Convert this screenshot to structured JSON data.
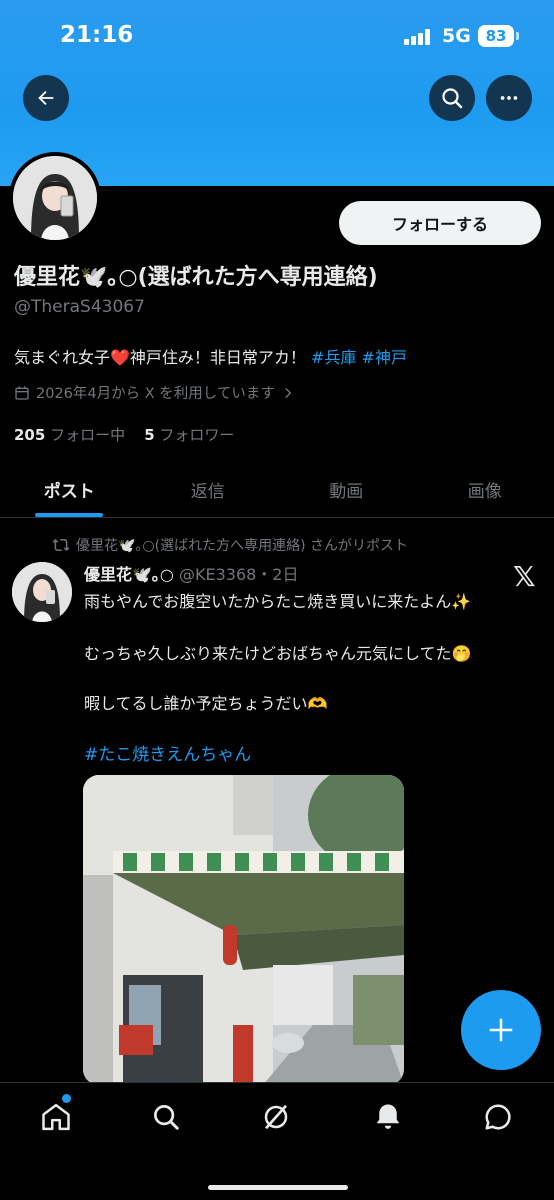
{
  "status_bar": {
    "time": "21:16",
    "network": "5G",
    "battery": "83"
  },
  "profile": {
    "display_name": "優里花🕊️｡○(選ばれた方へ専用連絡)",
    "handle": "@TheraS43067",
    "follow_button": "フォローする",
    "bio_text": "気まぐれ女子❤️神戸住み！非日常アカ！",
    "bio_tags": [
      "#兵庫",
      "#神戸"
    ],
    "joined": "2026年4月から X を利用しています",
    "following_count": "205",
    "following_label": "フォロー中",
    "followers_count": "5",
    "followers_label": "フォロワー"
  },
  "tabs": [
    {
      "label": "ポスト",
      "active": true
    },
    {
      "label": "返信",
      "active": false
    },
    {
      "label": "動画",
      "active": false
    },
    {
      "label": "画像",
      "active": false
    }
  ],
  "post": {
    "repost_label": "優里花🕊️｡○(選ばれた方へ専用連絡) さんがリポスト",
    "author_name": "優里花🕊️｡○",
    "author_handle_time": "@KE3368・2日",
    "lines": [
      "雨もやんでお腹空いたからたこ焼き買いに来たよん✨",
      "むっちゃ久しぶり来たけどおばちゃん元気にしてた🤭",
      "暇してるし誰か予定ちょうだい🫶"
    ],
    "hashtag": "#たこ焼きえんちゃん"
  },
  "colors": {
    "accent": "#1d9bf0",
    "background": "#000000",
    "muted": "#71767b"
  },
  "icons": {
    "header": [
      "back-arrow-icon",
      "search-icon",
      "more-icon"
    ],
    "nav": [
      "home-icon",
      "search-icon",
      "grok-icon",
      "notifications-icon",
      "messages-icon"
    ],
    "fab": "plus-icon"
  }
}
